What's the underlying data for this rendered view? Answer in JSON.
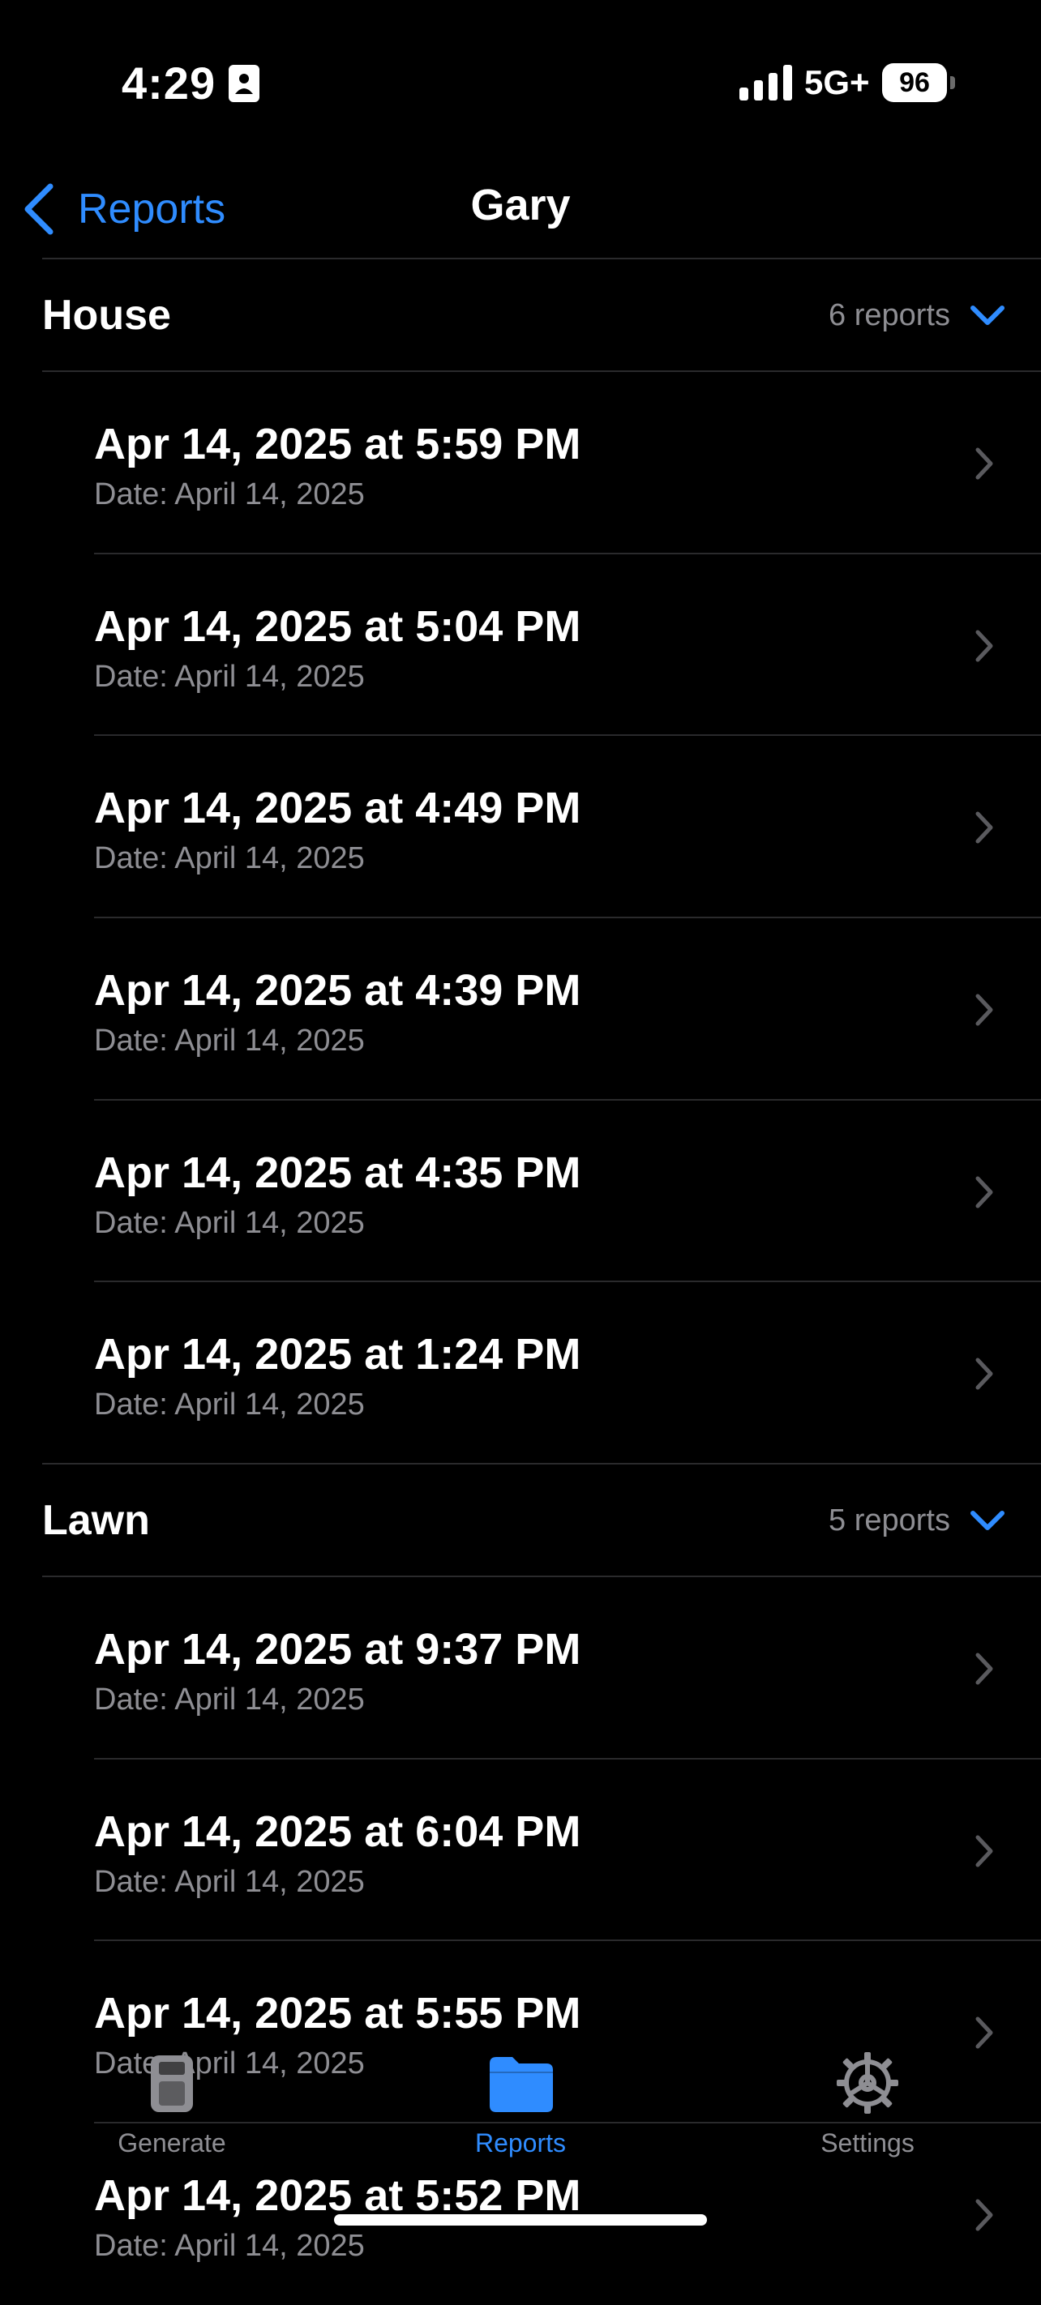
{
  "status": {
    "time": "4:29",
    "network": "5G+",
    "battery": "96"
  },
  "nav": {
    "back_label": "Reports",
    "title": "Gary"
  },
  "sections": [
    {
      "title": "House",
      "count": "6 reports",
      "rows": [
        {
          "title": "Apr 14, 2025 at 5:59 PM",
          "subtitle": "Date: April 14, 2025"
        },
        {
          "title": "Apr 14, 2025 at 5:04 PM",
          "subtitle": "Date: April 14, 2025"
        },
        {
          "title": "Apr 14, 2025 at 4:49 PM",
          "subtitle": "Date: April 14, 2025"
        },
        {
          "title": "Apr 14, 2025 at 4:39 PM",
          "subtitle": "Date: April 14, 2025"
        },
        {
          "title": "Apr 14, 2025 at 4:35 PM",
          "subtitle": "Date: April 14, 2025"
        },
        {
          "title": "Apr 14, 2025 at 1:24 PM",
          "subtitle": "Date: April 14, 2025"
        }
      ]
    },
    {
      "title": "Lawn",
      "count": "5 reports",
      "rows": [
        {
          "title": "Apr 14, 2025 at 9:37 PM",
          "subtitle": "Date: April 14, 2025"
        },
        {
          "title": "Apr 14, 2025 at 6:04 PM",
          "subtitle": "Date: April 14, 2025"
        },
        {
          "title": "Apr 14, 2025 at 5:55 PM",
          "subtitle": "Date: April 14, 2025"
        },
        {
          "title": "Apr 14, 2025 at 5:52 PM",
          "subtitle": "Date: April 14, 2025"
        }
      ]
    }
  ],
  "tabs": [
    {
      "label": "Generate",
      "icon": "document-icon",
      "active": false
    },
    {
      "label": "Reports",
      "icon": "folder-icon",
      "active": true
    },
    {
      "label": "Settings",
      "icon": "gear-icon",
      "active": false
    }
  ],
  "colors": {
    "accent": "#2f8cff",
    "secondary_text": "#8e8e93",
    "background": "#000000",
    "separator": "#2a2a2c"
  }
}
